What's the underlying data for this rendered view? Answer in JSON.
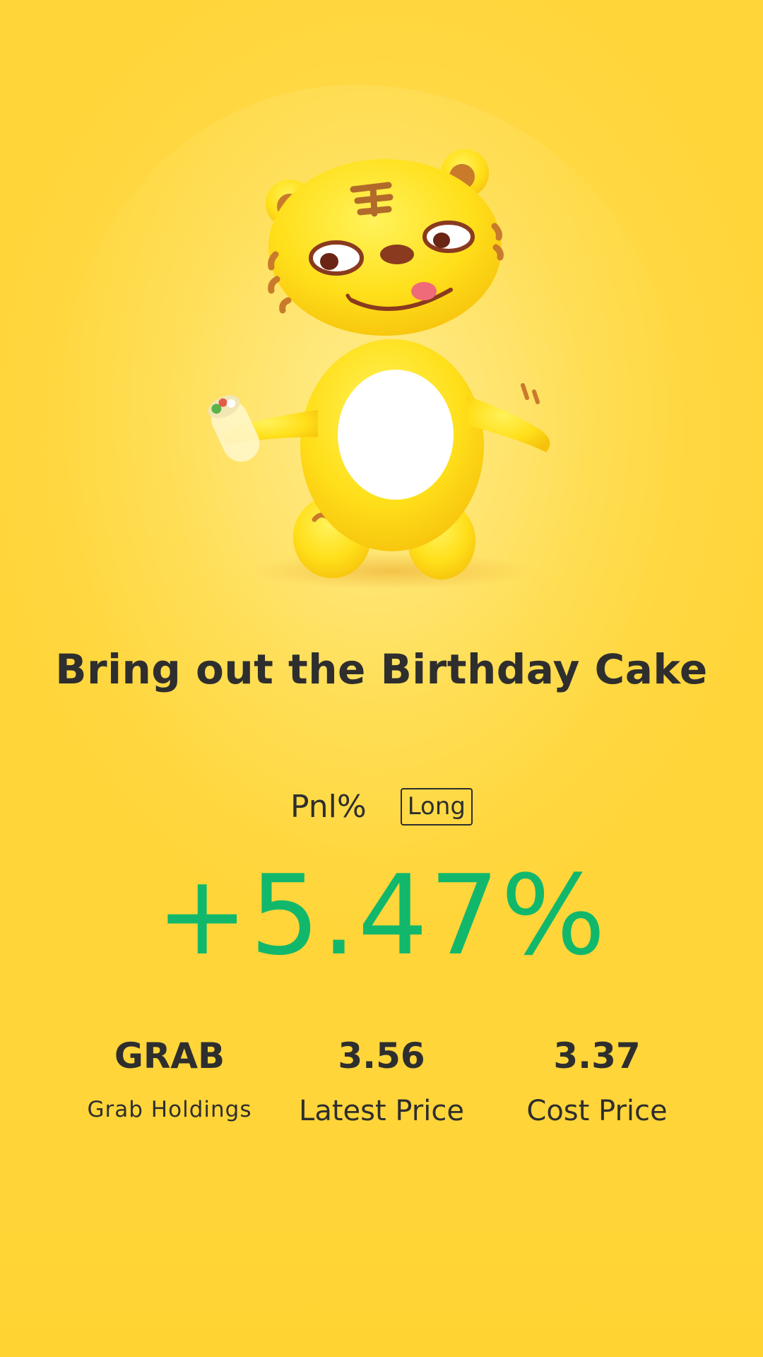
{
  "headline": "Bring out the Birthday Cake",
  "pnl": {
    "label": "Pnl%",
    "position_badge": "Long",
    "value": "+5.47%",
    "value_color": "#11b86b"
  },
  "stock": {
    "symbol": "GRAB",
    "name": "Grab Holdings",
    "latest_price": "3.56",
    "latest_price_label": "Latest Price",
    "cost_price": "3.37",
    "cost_price_label": "Cost Price"
  },
  "mascot_icon": "tiger-mascot-icon",
  "colors": {
    "background": "#ffd53a",
    "text": "#2e2e2e",
    "gain": "#11b86b"
  }
}
